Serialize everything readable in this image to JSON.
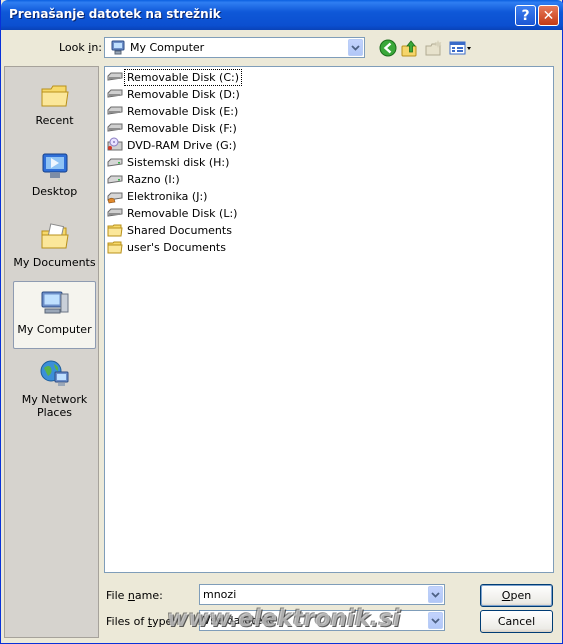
{
  "window": {
    "title": "Prenašanje datotek na strežnik",
    "help_glyph": "?",
    "close_glyph": "✕"
  },
  "look_in": {
    "label_prefix": "Look ",
    "label_accel": "i",
    "label_suffix": "n:",
    "value": "My Computer",
    "icon": "my-computer-icon"
  },
  "toolbar": {
    "icons": [
      "back-icon",
      "up-folder-icon",
      "new-folder-icon",
      "views-menu-icon"
    ]
  },
  "places": [
    {
      "label": "Recent",
      "icon": "recent-folder-icon"
    },
    {
      "label": "Desktop",
      "icon": "desktop-icon"
    },
    {
      "label": "My Documents",
      "icon": "my-documents-icon"
    },
    {
      "label": "My Computer",
      "icon": "my-computer-icon",
      "selected": true
    },
    {
      "label": "My Network Places",
      "icon": "network-places-icon"
    }
  ],
  "files": [
    {
      "name": "Removable Disk (C:)",
      "icon": "removable-disk-icon",
      "focused": true
    },
    {
      "name": "Removable Disk (D:)",
      "icon": "removable-disk-icon"
    },
    {
      "name": "Removable Disk (E:)",
      "icon": "removable-disk-icon"
    },
    {
      "name": "Removable Disk (F:)",
      "icon": "removable-disk-icon"
    },
    {
      "name": "DVD-RAM Drive (G:)",
      "icon": "dvd-drive-icon"
    },
    {
      "name": "Sistemski disk (H:)",
      "icon": "hard-disk-icon"
    },
    {
      "name": "Razno (I:)",
      "icon": "hard-disk-icon"
    },
    {
      "name": "Elektronika (J:)",
      "icon": "shared-disk-icon"
    },
    {
      "name": "Removable Disk (L:)",
      "icon": "removable-disk-icon"
    },
    {
      "name": "Shared Documents",
      "icon": "folder-icon"
    },
    {
      "name": "user's Documents",
      "icon": "folder-icon"
    }
  ],
  "file_name": {
    "label_prefix": "File ",
    "label_accel": "n",
    "label_suffix": "ame:",
    "value": "mnozi"
  },
  "file_type": {
    "label_prefix": "Files of ",
    "label_accel": "t",
    "label_suffix": "ype:",
    "value": "Vse datoteke"
  },
  "buttons": {
    "open_accel": "O",
    "open_rest": "pen",
    "cancel": "Cancel"
  },
  "watermark": "www.elektronik.si",
  "colors": {
    "titlebar": "#0b4fd0",
    "dialog_bg": "#ece9d8",
    "places_bg": "#d6d3ce",
    "border_blue": "#7f9db9"
  }
}
